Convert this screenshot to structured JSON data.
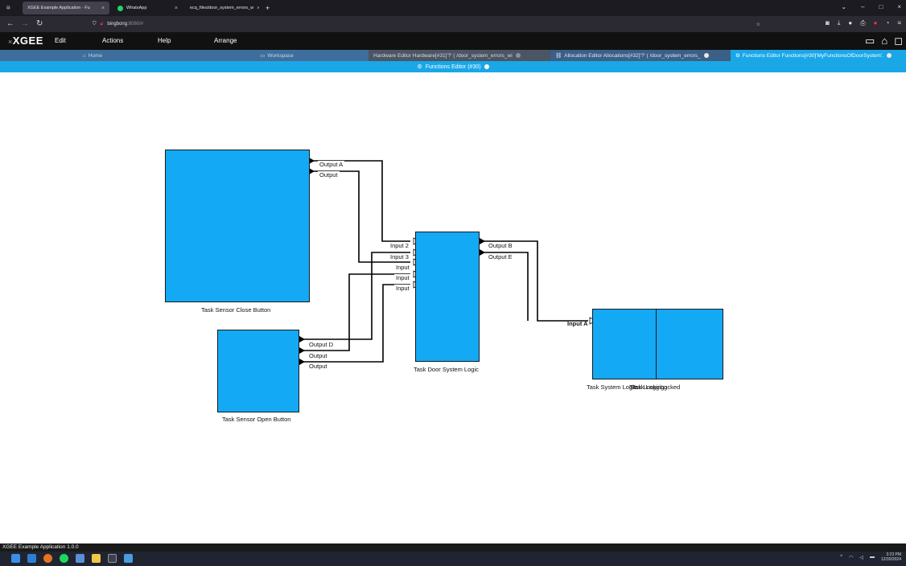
{
  "browser": {
    "tabs": [
      {
        "label": "XGEE Example Application - Fu",
        "close": "×"
      },
      {
        "label": "WhatsApp",
        "close": "×"
      },
      {
        "label": "ecq_files/door_system_errors_w",
        "close": "×"
      }
    ],
    "new_tab": "+",
    "url_host": "bingbong",
    "url_rest": ":8080/#",
    "window_controls": [
      "⌄",
      "–",
      "□",
      "×"
    ]
  },
  "app": {
    "logo": "XGEE",
    "menu": [
      "Edit",
      "Actions",
      "Help",
      "Arrange"
    ]
  },
  "editor_tabs": [
    {
      "label": "Home"
    },
    {
      "label": "Workspace"
    },
    {
      "label": "Hardware Editor Hardware[#31]'?' ( /door_system_errors_wi"
    },
    {
      "label": "Allocation Editor Allocations[#32]'?' ( /door_system_errors_"
    },
    {
      "label": "Functions Editor Functions[#30]'MyFunctionsOfDoorSystem'."
    }
  ],
  "editor_title": "Functions Editor (#30)",
  "diagram": {
    "tasks": [
      {
        "label": "Task Sensor Close Button"
      },
      {
        "label": "Task Sensor Open Button"
      },
      {
        "label": "Task Door System Logic"
      },
      {
        "label": "Task System Logic"
      },
      {
        "label": "Task Locking"
      },
      {
        "label": "Task Logging"
      },
      {
        "label": "Locked"
      }
    ],
    "ports": {
      "close_out_a": "Output A",
      "close_out": "Output",
      "open_out_d": "Output D",
      "open_out_1": "Output",
      "open_out_2": "Output",
      "logic_in_2": "Input 2",
      "logic_in_3": "Input 3",
      "logic_in_a": "Input",
      "logic_in_b": "Input",
      "logic_in_c": "Input",
      "logic_out_b": "Output B",
      "logic_out_e": "Output E",
      "sys_in_a": "Input A"
    }
  },
  "status_bar": "XGEE Example Application 1.0.0",
  "clock": {
    "time": "3:23 PM",
    "date": "12/30/2024"
  }
}
